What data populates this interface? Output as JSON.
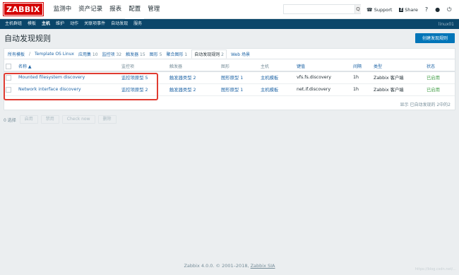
{
  "logo": "ZABBIX",
  "main_menu": [
    "监测中",
    "资产记录",
    "报表",
    "配置",
    "管理"
  ],
  "main_menu_active": 3,
  "search": {
    "value": "",
    "button": "Q"
  },
  "top_links": {
    "support": "Support",
    "share": "Share",
    "share_badge": "Z",
    "help": "?",
    "user": "user-icon",
    "logout": "power-icon"
  },
  "sub_menu": [
    "主机群组",
    "模板",
    "主机",
    "维护",
    "动作",
    "关联项事件",
    "自动发现",
    "服务"
  ],
  "sub_menu_active": 2,
  "sub_menu_right": "linux01",
  "page_title": "自动发现规则",
  "create_button": "创建发现规则",
  "breadcrumbs": {
    "all_templates": "所有模板",
    "separator": "/",
    "template": "Template OS Linux",
    "tabs": [
      {
        "label": "应用集",
        "count": "10"
      },
      {
        "label": "监控项",
        "count": "32"
      },
      {
        "label": "触发器",
        "count": "15"
      },
      {
        "label": "图形",
        "count": "5"
      },
      {
        "label": "聚合图形",
        "count": "1"
      },
      {
        "label": "自动发现规则",
        "count": "2"
      },
      {
        "label": "Web 场景",
        "count": ""
      }
    ],
    "active_tab": 5
  },
  "table": {
    "headers": [
      "名称 ▲",
      "监控项",
      "触发器",
      "图形",
      "主机",
      "键值",
      "间隔",
      "类型",
      "状态"
    ],
    "rows": [
      {
        "name": "Mounted filesystem discovery",
        "items": "监控项原型 5",
        "triggers": "触发器类型 2",
        "graphs": "图形原型 1",
        "hosts": "主机模板",
        "key": "vfs.fs.discovery",
        "interval": "1h",
        "type": "Zabbix 客户端",
        "status": "已启用"
      },
      {
        "name": "Network interface discovery",
        "items": "监控项原型 2",
        "triggers": "触发器类型 2",
        "graphs": "图形原型 1",
        "hosts": "主机模板",
        "key": "net.if.discovery",
        "interval": "1h",
        "type": "Zabbix 客户端",
        "status": "已启用"
      }
    ],
    "summary": "显示 已自动发现的 2中的2"
  },
  "actions": {
    "selected": "0 选择",
    "buttons": [
      "启用",
      "禁用",
      "Check now",
      "删除"
    ]
  },
  "footer": {
    "text": "Zabbix 4.0.0. © 2001–2018,",
    "link": "Zabbix SIA"
  },
  "watermark": "https://blog.csdn.net/..."
}
